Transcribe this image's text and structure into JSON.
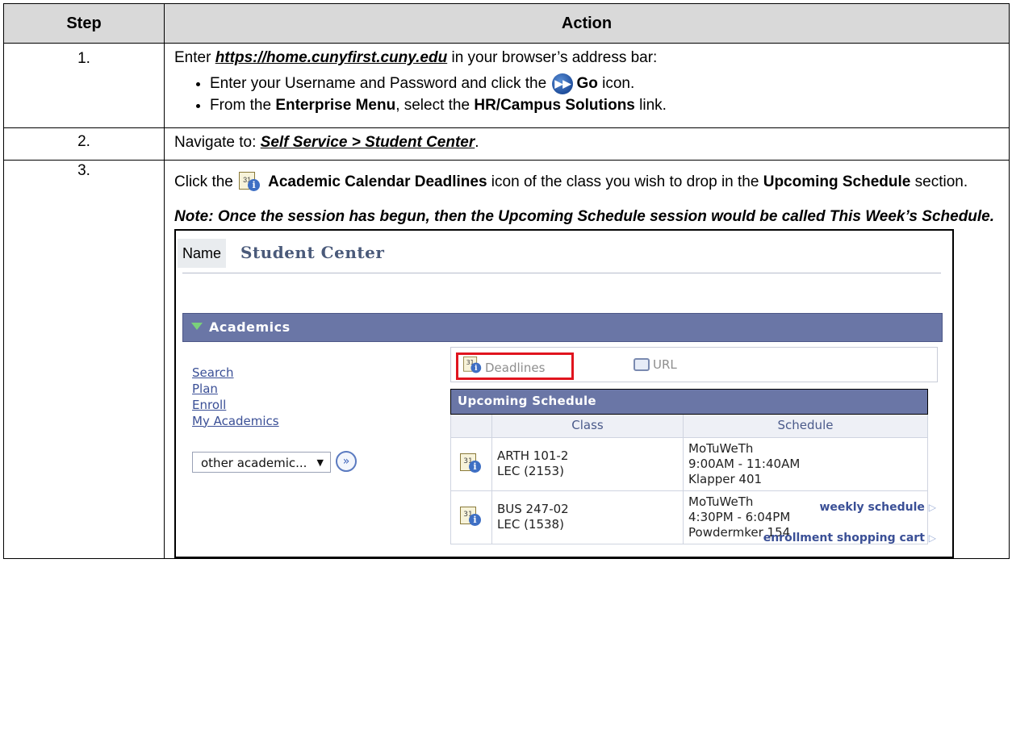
{
  "table": {
    "header_step": "Step",
    "header_action": "Action"
  },
  "steps": [
    {
      "number": "1.",
      "intro_before": "Enter ",
      "intro_link": "https://home.cunyfirst.cuny.edu",
      "intro_after": " in your browser’s address bar:",
      "bullet1_before": "Enter your Username and Password and click the ",
      "bullet1_go": "Go",
      "bullet1_after": " icon.",
      "bullet2_a": "From the ",
      "bullet2_b": "Enterprise Menu",
      "bullet2_c": ", select the ",
      "bullet2_d": "HR/Campus Solutions",
      "bullet2_e": " link."
    },
    {
      "number": "2.",
      "text_before": "Navigate to:  ",
      "path": "Self Service > Student Center",
      "text_after": "."
    },
    {
      "number": "3.",
      "text_a": "Click the ",
      "text_b": "Academic Calendar Deadlines",
      "text_c": " icon of the class you wish to drop in the ",
      "text_d": "Upcoming Schedule",
      "text_e": " section.",
      "note": "Note:  Once the session has begun, then the Upcoming Schedule session would be called This Week’s Schedule."
    }
  ],
  "screenshot": {
    "name_label": "Name",
    "title": "Student Center",
    "section": "Academics",
    "links": [
      "Search",
      "Plan",
      "Enroll",
      "My Academics"
    ],
    "dropdown_value": "other academic...",
    "deadlines_label": "Deadlines",
    "url_label": "URL",
    "schedule_title": "Upcoming Schedule",
    "col_class": "Class",
    "col_schedule": "Schedule",
    "rows": [
      {
        "class1": "ARTH 101-2",
        "class2": "LEC (2153)",
        "days": "MoTuWeTh",
        "time": "9:00AM - 11:40AM",
        "room": "Klapper 401"
      },
      {
        "class1": "BUS 247-02",
        "class2": "LEC (1538)",
        "days": "MoTuWeTh",
        "time": "4:30PM - 6:04PM",
        "room": "Powdermker 154"
      }
    ],
    "weekly_link": "weekly schedule",
    "cart_link": "enrollment shopping cart"
  },
  "icons": {
    "go": "go-arrow-icon",
    "calendar": "calendar-deadlines-icon",
    "url": "url-icon"
  },
  "colors": {
    "header_gray": "#d9d9d9",
    "bar_blue": "#6a76a6",
    "highlight_red": "#e0141e",
    "link_blue": "#3a4f96"
  }
}
